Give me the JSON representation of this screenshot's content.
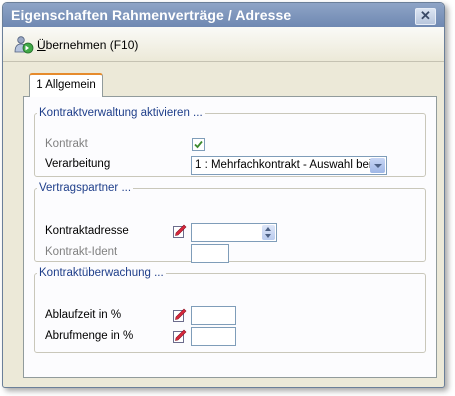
{
  "window": {
    "title": "Eigenschaften Rahmenverträge / Adresse",
    "close_glyph": "✕"
  },
  "toolbar": {
    "apply_hotkey": "Ü",
    "apply_rest": "bernehmen (F10)"
  },
  "tabs": [
    {
      "label": "1 Allgemein",
      "selected": true
    }
  ],
  "sections": {
    "kontraktverwaltung": {
      "legend": "Kontraktverwaltung aktivieren ...",
      "kontrakt_label": "Kontrakt",
      "kontrakt_checked": true,
      "verarbeitung_label": "Verarbeitung",
      "verarbeitung_value": "1 : Mehrfachkontrakt - Auswahl bei"
    },
    "vertragspartner": {
      "legend": "Vertragspartner ...",
      "kontraktadresse_label": "Kontraktadresse",
      "kontraktadresse_value": "",
      "kontrakt_ident_label": "Kontrakt-Ident",
      "kontrakt_ident_value": ""
    },
    "kontraktueberwachung": {
      "legend": "Kontraktüberwachung ...",
      "ablaufzeit_label": "Ablaufzeit in %",
      "ablaufzeit_value": "",
      "abrufmenge_label": "Abrufmenge in %",
      "abrufmenge_value": ""
    }
  },
  "colors": {
    "accent": "#e68b2c",
    "legend": "#1e3e8a",
    "titlebar": "#7a92bb",
    "dialog_bg": "#ece9d8"
  },
  "icons": {
    "apply": "apply-changes-icon",
    "edit": "edit-pencil-icon",
    "close": "close-icon",
    "dropdown": "chevron-down-icon",
    "spin": "spinner-icon",
    "check": "checkmark-icon"
  }
}
